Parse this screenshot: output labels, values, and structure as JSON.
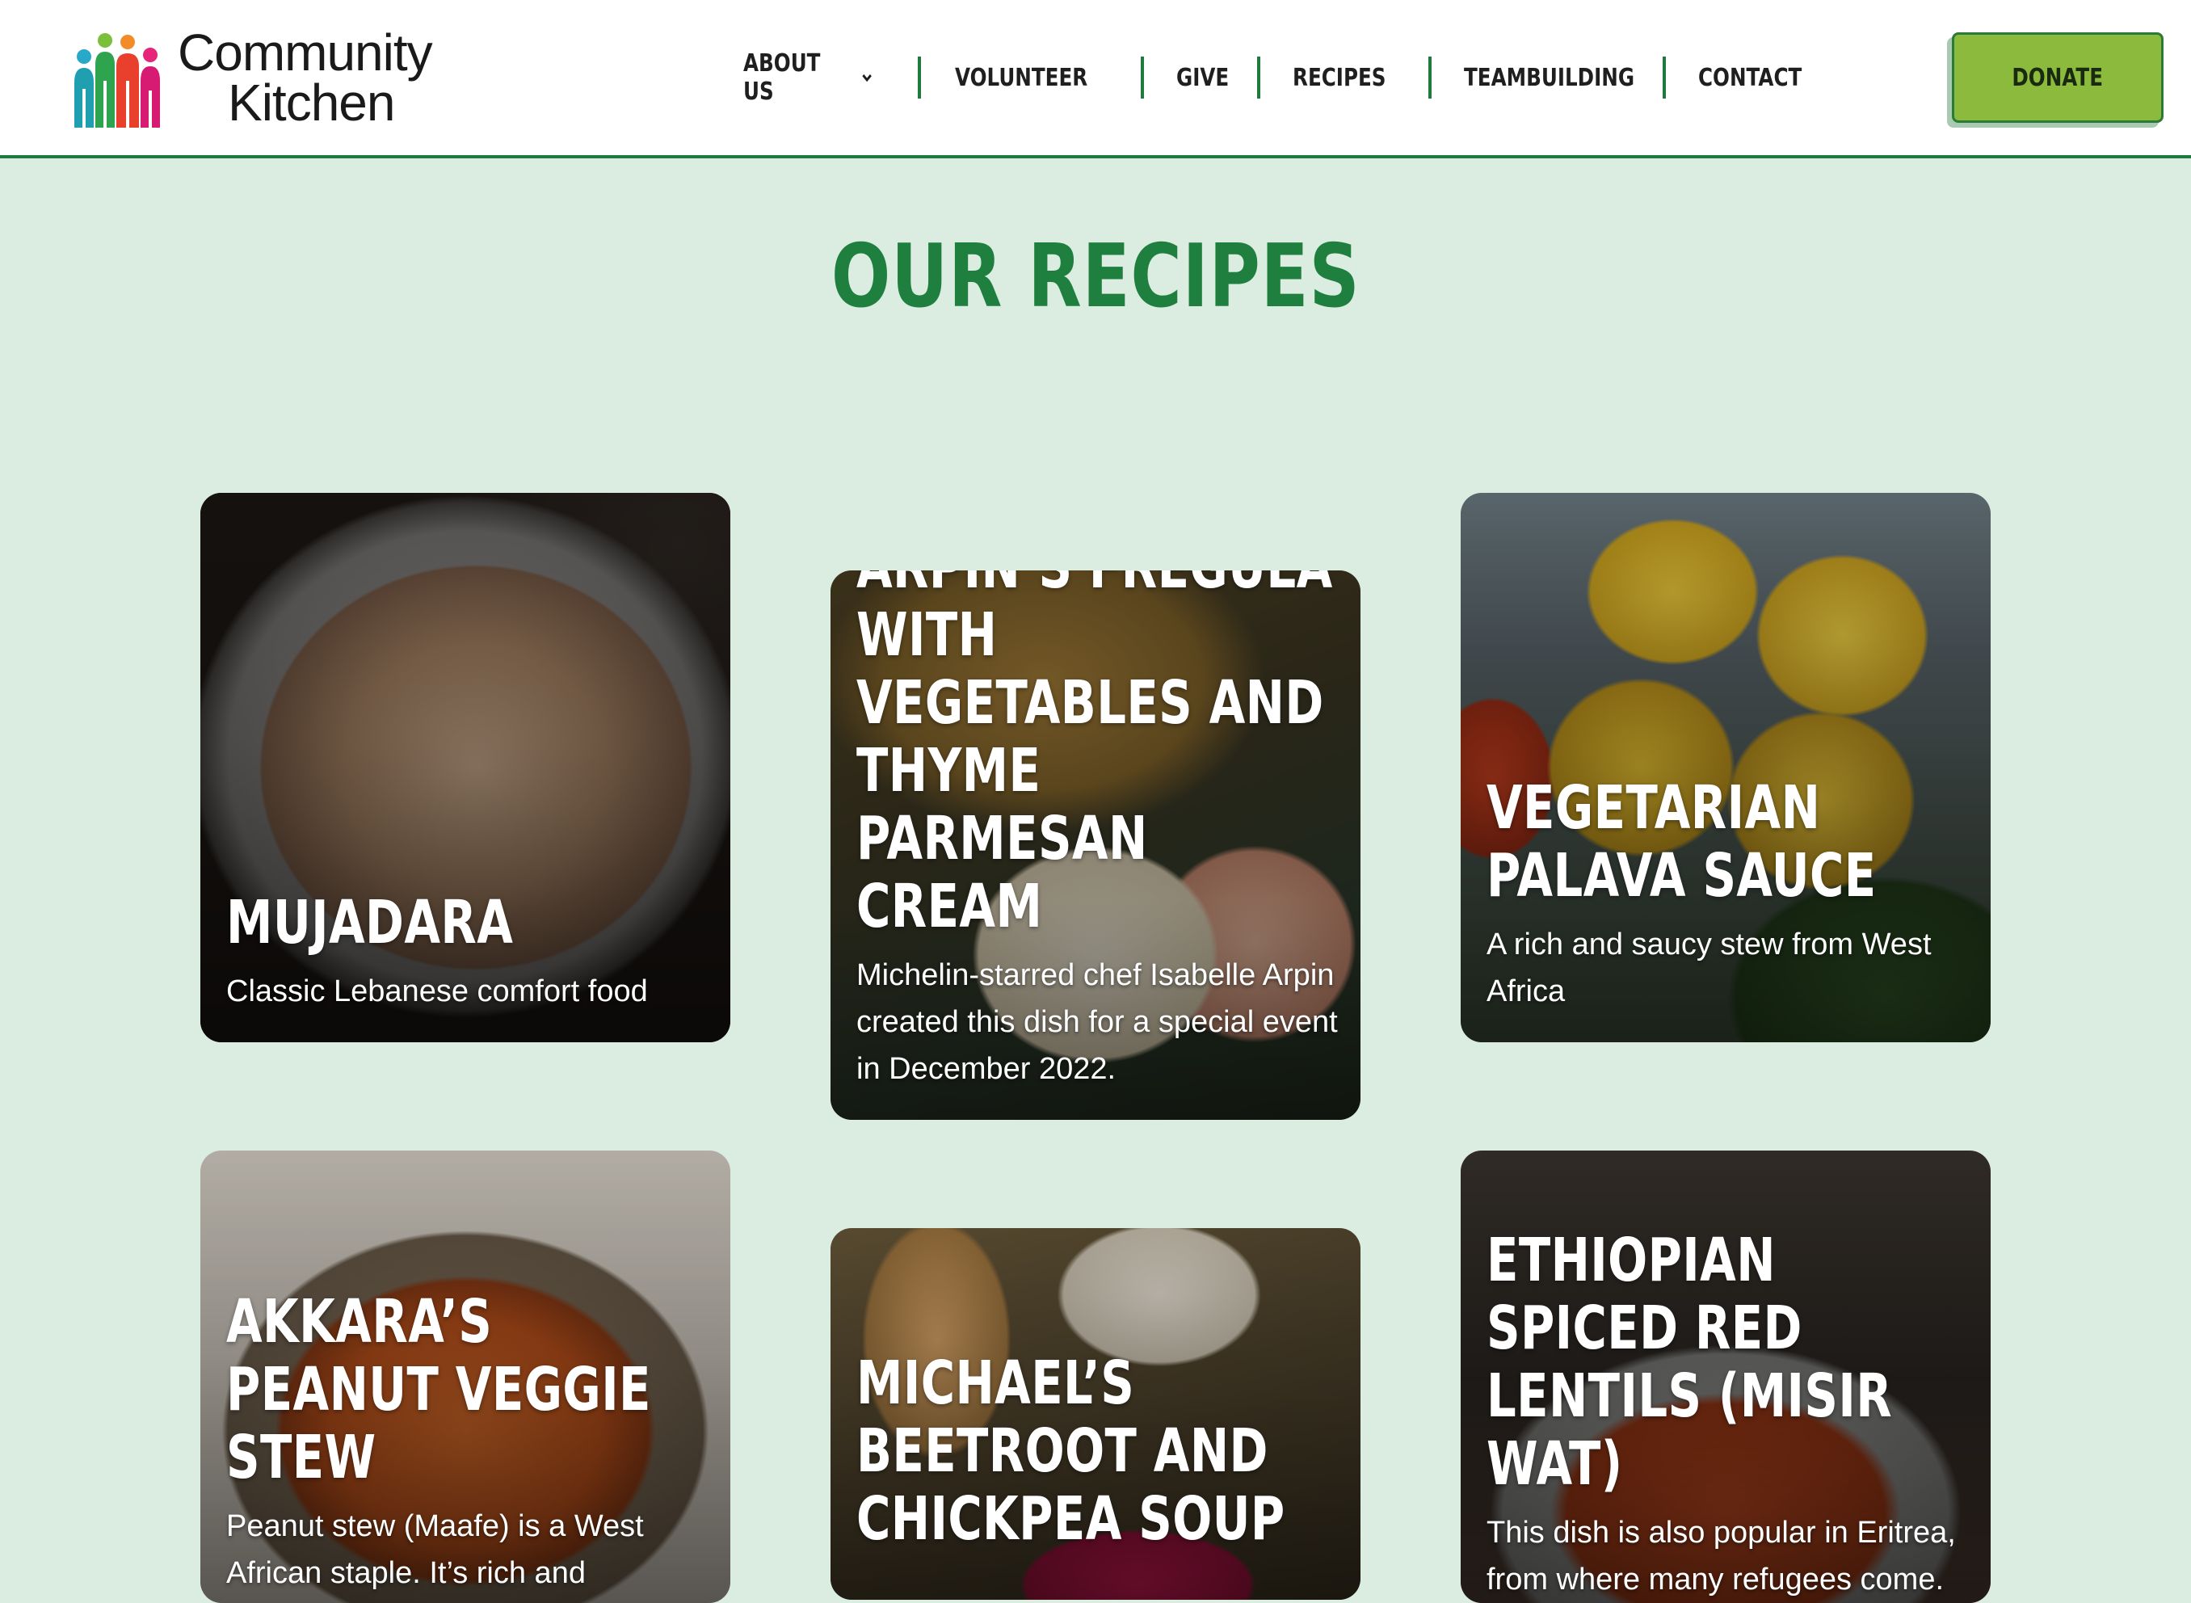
{
  "logo": {
    "line1": "Community",
    "line2": "Kitchen"
  },
  "nav": {
    "items": [
      {
        "label": "ABOUT US",
        "dropdown": true
      },
      {
        "label": "VOLUNTEER",
        "dropdown": true
      },
      {
        "label": "GIVE",
        "dropdown": false
      },
      {
        "label": "RECIPES",
        "dropdown": false
      },
      {
        "label": "TEAMBUILDING",
        "dropdown": false
      },
      {
        "label": "CONTACT",
        "dropdown": false
      }
    ],
    "donate_label": "DONATE"
  },
  "colors": {
    "accent": "#1f7f3e",
    "donate": "#8cba3c",
    "background": "#dbece1"
  },
  "page_title": "OUR RECIPES",
  "recipes": [
    {
      "title": "MUJADARA",
      "description": "Classic Lebanese comfort food"
    },
    {
      "title": "ISABELLE ARPIN’S FREGULA WITH VEGETABLES AND THYME PARMESAN CREAM",
      "description": "Michelin-starred chef Isabelle Arpin created this dish for a special event in December 2022."
    },
    {
      "title": "VEGETARIAN PALAVA SAUCE",
      "description": "A rich and saucy stew from West Africa"
    },
    {
      "title": "AKKARA’S PEANUT VEGGIE STEW",
      "description": "Peanut stew (Maafe) is a West African staple. It’s rich and"
    },
    {
      "title": "MICHAEL’S BEETROOT AND CHICKPEA SOUP",
      "description": ""
    },
    {
      "title": "ETHIOPIAN SPICED RED LENTILS (MISIR WAT)",
      "description": "This dish is also popular in Eritrea, from where many refugees come."
    }
  ]
}
